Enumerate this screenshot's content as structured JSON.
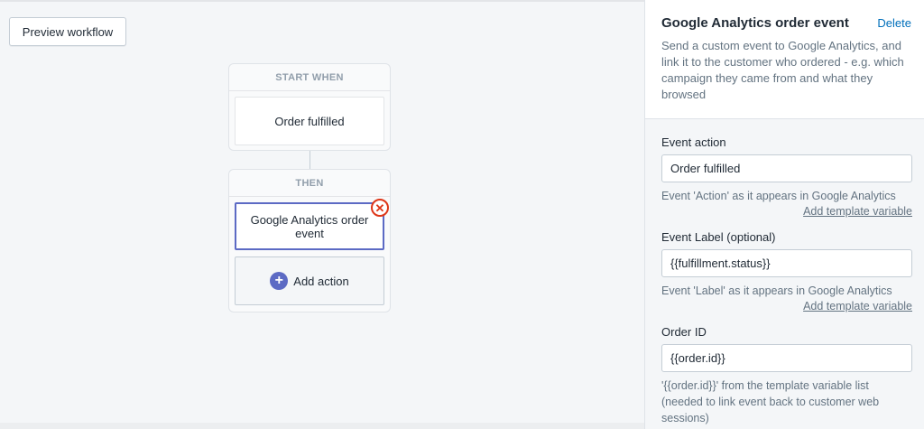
{
  "canvas": {
    "preview_button": "Preview workflow",
    "start_section": {
      "title": "START WHEN",
      "trigger": "Order fulfilled"
    },
    "then_section": {
      "title": "THEN",
      "action": "Google Analytics order event",
      "add_action": "Add action"
    }
  },
  "panel": {
    "title": "Google Analytics order event",
    "delete": "Delete",
    "description": "Send a custom event to Google Analytics, and link it to the customer who ordered - e.g. which campaign they came from and what they browsed",
    "fields": [
      {
        "label": "Event action",
        "value": "Order fulfilled",
        "help": "Event 'Action' as it appears in Google Analytics",
        "link": "Add template variable"
      },
      {
        "label": "Event Label (optional)",
        "value": "{{fulfillment.status}}",
        "help": "Event 'Label' as it appears in Google Analytics",
        "link": "Add template variable"
      },
      {
        "label": "Order ID",
        "value": "{{order.id}}",
        "help": "'{{order.id}}' from the template variable list (needed to link event back to customer web sessions)"
      }
    ]
  },
  "colors": {
    "accent": "#5c6ac4",
    "link": "#006fbb",
    "remove": "#de3618"
  },
  "icons": {
    "add": "plus-circle-icon",
    "remove": "close-circle-icon"
  }
}
